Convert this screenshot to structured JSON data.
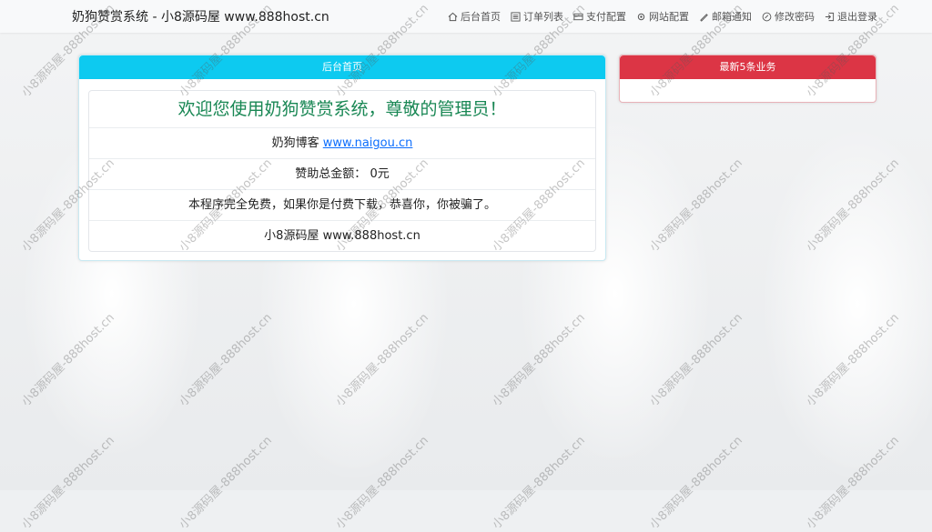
{
  "header": {
    "brand": "奶狗赞赏系统 - 小8源码屋 www.888host.cn",
    "nav": [
      {
        "label": "后台首页",
        "icon": "home-icon"
      },
      {
        "label": "订单列表",
        "icon": "list-icon"
      },
      {
        "label": "支付配置",
        "icon": "card-icon"
      },
      {
        "label": "网站配置",
        "icon": "gear-icon"
      },
      {
        "label": "邮箱通知",
        "icon": "pen-icon"
      },
      {
        "label": "修改密码",
        "icon": "circle-check-icon"
      },
      {
        "label": "退出登录",
        "icon": "logout-icon"
      }
    ]
  },
  "main_card": {
    "title": "后台首页",
    "header_color": "#0dcaf0",
    "welcome": "欢迎您使用奶狗赞赏系统，尊敬的管理员！",
    "welcome_color": "#198754",
    "blog_label": "奶狗博客",
    "blog_link": "www.naigou.cn",
    "amount_label": "赞助总金额：",
    "amount_value": "0元",
    "notice": "本程序完全免费，如果你是付费下载，恭喜你，你被骗了。",
    "footer_text": "小8源码屋 www.888host.cn"
  },
  "side_card": {
    "title": "最新5条业务",
    "header_color": "#dc3545"
  },
  "watermark": "小8源码屋-888host.cn"
}
